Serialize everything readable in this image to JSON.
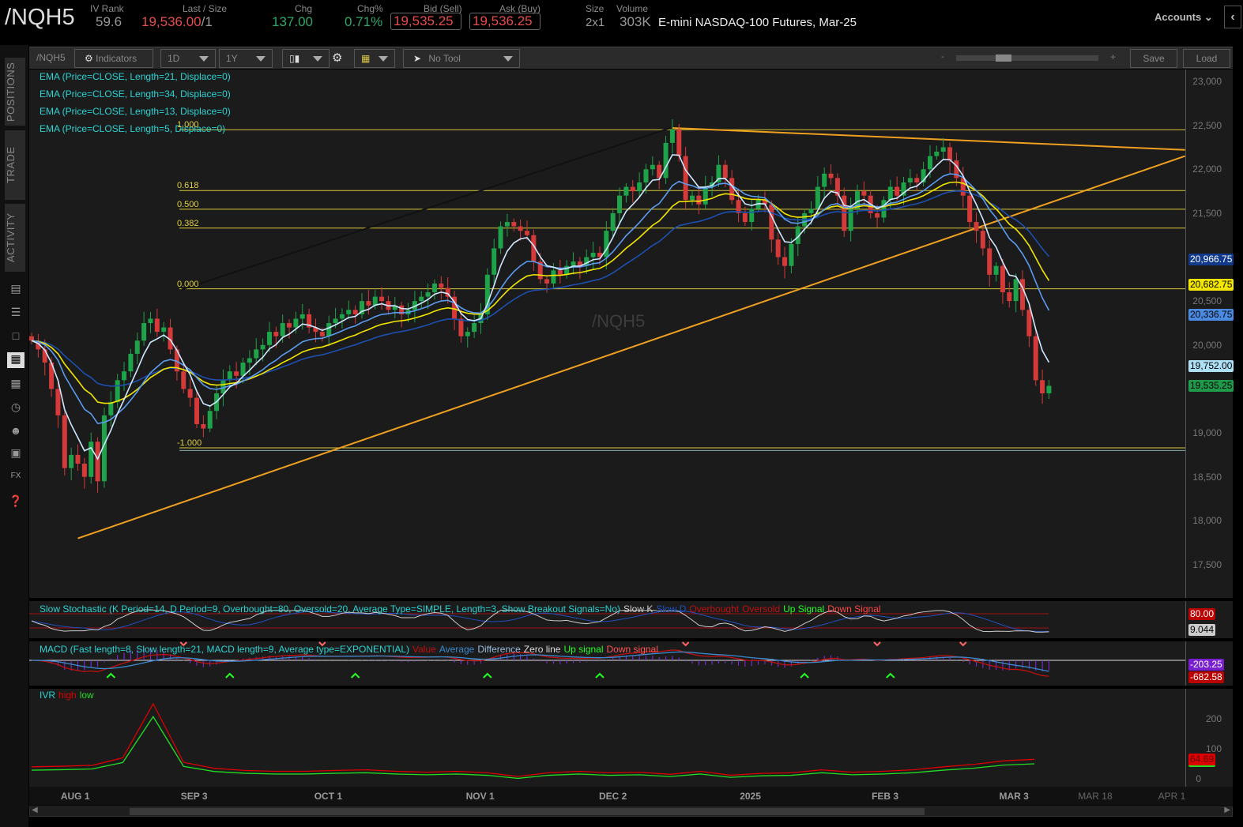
{
  "header": {
    "symbol": "/NQH5",
    "iv_rank_label": "IV Rank",
    "iv_rank": "59.6",
    "last_label": "Last / Size",
    "last": "19,536.00",
    "last_size": "/1",
    "chg_label": "Chg",
    "chg": "137.00",
    "chgpct_label": "Chg%",
    "chgpct": "0.71%",
    "bid_label": "Bid (Sell)",
    "bid": "19,535.25",
    "ask_label": "Ask (Buy)",
    "ask": "19,536.25",
    "size_label": "Size",
    "size": "2x1",
    "volume_label": "Volume",
    "volume": "303K",
    "description": "E-mini NASDAQ-100 Futures, Mar-25",
    "accounts": "Accounts"
  },
  "toolbar": {
    "symbol": "/NQH5",
    "indicators": "Indicators",
    "aggregation": "1D",
    "period": "1Y",
    "tool": "No Tool",
    "zoom_minus": "-",
    "zoom_plus": "+",
    "save": "Save",
    "load": "Load"
  },
  "sidebar": {
    "tabs": [
      "POSITIONS",
      "TRADE",
      "ACTIVITY"
    ]
  },
  "watermark": "/NQH5",
  "legend": {
    "ema21": "EMA (Price=CLOSE, Length=21, Displace=0)",
    "ema34": "EMA (Price=CLOSE, Length=34, Displace=0)",
    "ema13": "EMA (Price=CLOSE, Length=13, Displace=0)",
    "ema5": "EMA (Price=CLOSE, Length=5, Displace=0)"
  },
  "stoch": {
    "title": "Slow Stochastic (K Period=14, D Period=9, Overbought=80, Oversold=20, Average Type=SIMPLE, Length=3, Show Breakout Signals=No)",
    "items": [
      "Slow K",
      "Slow D",
      "Overbought",
      "Oversold",
      "Up Signal",
      "Down Signal"
    ],
    "badge_ob": "80.00",
    "badge_k": "9.044"
  },
  "macd": {
    "title": "MACD (Fast length=8, Slow length=21, MACD length=9, Average type=EXPONENTIAL)",
    "items": [
      "Value",
      "Average",
      "Difference",
      "Zero line",
      "Up signal",
      "Down signal"
    ],
    "badge_avg": "-203.25",
    "badge_val": "-682.58",
    "up_signals": [
      12,
      30,
      49,
      69,
      86,
      117,
      130
    ],
    "down_signals": [
      23,
      44,
      99,
      128,
      141
    ]
  },
  "ivr": {
    "title": "IVR",
    "high": "high",
    "low": "low",
    "ticks": [
      "200",
      "100",
      "0"
    ],
    "badge": "64.69",
    "values": [
      40,
      42,
      45,
      70,
      250,
      55,
      35,
      28,
      25,
      25,
      28,
      30,
      25,
      22,
      25,
      20,
      8,
      20,
      25,
      20,
      22,
      15,
      25,
      12,
      18,
      20,
      30,
      22,
      25,
      30,
      40,
      48,
      60,
      65
    ]
  },
  "price_badges": [
    {
      "label": "20,966.75",
      "bg": "#123a8c",
      "fg": "#fff",
      "price": 20966.75
    },
    {
      "label": "20,682.75",
      "bg": "#f2e600",
      "fg": "#000",
      "price": 20682.75
    },
    {
      "label": "20,336.75",
      "bg": "#4a8ae0",
      "fg": "#000",
      "price": 20336.75
    },
    {
      "label": "19,752.00",
      "bg": "#aee0f5",
      "fg": "#000",
      "price": 19752
    },
    {
      "label": "19,535.25",
      "bg": "#1f9a4a",
      "fg": "#000",
      "price": 19535.25
    }
  ],
  "price_ticks": [
    "23,000",
    "22,500",
    "22,000",
    "21,500",
    "21,000",
    "20,500",
    "20,000",
    "19,500",
    "19,000",
    "18,500",
    "18,000",
    "17,500"
  ],
  "dates": [
    {
      "label": "AUG 1",
      "bar": 6.6
    },
    {
      "label": "SEP 3",
      "bar": 24.6
    },
    {
      "label": "OCT 1",
      "bar": 44.9
    },
    {
      "label": "NOV 1",
      "bar": 67.9
    },
    {
      "label": "DEC 2",
      "bar": 88
    },
    {
      "label": "2025",
      "bar": 108.8
    },
    {
      "label": "FEB 3",
      "bar": 129.2
    },
    {
      "label": "MAR 3",
      "bar": 148.7
    },
    {
      "label": "MAR 18",
      "bar": 161
    },
    {
      "label": "APR 1",
      "bar": 172.6
    }
  ],
  "fib": [
    {
      "label": "1.000",
      "price": 22450
    },
    {
      "label": "0.618",
      "price": 21758
    },
    {
      "label": "0.500",
      "price": 21545
    },
    {
      "label": "0.382",
      "price": 21331
    },
    {
      "label": "0.000",
      "price": 20640
    },
    {
      "label": "-1.000",
      "price": 18830
    }
  ],
  "colors": {
    "up": "#1fa34a",
    "down": "#d43a3a",
    "ema5": "#cfe8ff",
    "ema13": "#5b9cf0",
    "ema21": "#f2e600",
    "ema34": "#1d4fb0",
    "trend": "#f0a020"
  },
  "chart_data": {
    "type": "candlestick",
    "ylim": [
      17300,
      23150
    ],
    "trendlines": [
      {
        "from": [
          7,
          17800
        ],
        "to": [
          174.6,
          22150
        ]
      },
      {
        "from": [
          97,
          22470
        ],
        "to": [
          174.6,
          22220
        ]
      },
      {
        "from": [
          22.7,
          20630
        ],
        "to": [
          96.7,
          22470
        ]
      }
    ],
    "closes": [
      20050,
      19950,
      19800,
      19500,
      19200,
      18600,
      18750,
      18650,
      18500,
      18900,
      18450,
      19200,
      19350,
      19600,
      19700,
      19900,
      20050,
      20250,
      20300,
      20150,
      20200,
      19950,
      19700,
      19500,
      19400,
      19100,
      19050,
      19250,
      19450,
      19600,
      19700,
      19650,
      19800,
      19850,
      19950,
      20000,
      20150,
      20100,
      20250,
      20200,
      20300,
      20350,
      20200,
      20150,
      20100,
      20250,
      20300,
      20350,
      20400,
      20350,
      20500,
      20450,
      20550,
      20500,
      20400,
      20450,
      20350,
      20400,
      20500,
      20550,
      20600,
      20700,
      20650,
      20550,
      20300,
      20100,
      20150,
      20250,
      20350,
      20800,
      21100,
      21350,
      21400,
      21350,
      21300,
      21250,
      20950,
      20750,
      20700,
      20850,
      20800,
      20900,
      20950,
      20900,
      21000,
      21050,
      21000,
      21300,
      21500,
      21700,
      21800,
      21750,
      21850,
      22000,
      22050,
      21900,
      22300,
      22450,
      22150,
      21650,
      21700,
      21600,
      21800,
      21850,
      22050,
      21900,
      21650,
      21500,
      21400,
      21550,
      21650,
      21600,
      21200,
      21000,
      20900,
      21150,
      21350,
      21500,
      21550,
      21800,
      21950,
      21900,
      21700,
      21300,
      21550,
      21750,
      21700,
      21500,
      21450,
      21650,
      21800,
      21700,
      21850,
      21900,
      21850,
      22000,
      22150,
      22200,
      22250,
      22100,
      21900,
      21700,
      21400,
      21300,
      21100,
      20800,
      20900,
      20600,
      20500,
      20750,
      20400,
      20100,
      19600,
      19450,
      19536
    ]
  }
}
